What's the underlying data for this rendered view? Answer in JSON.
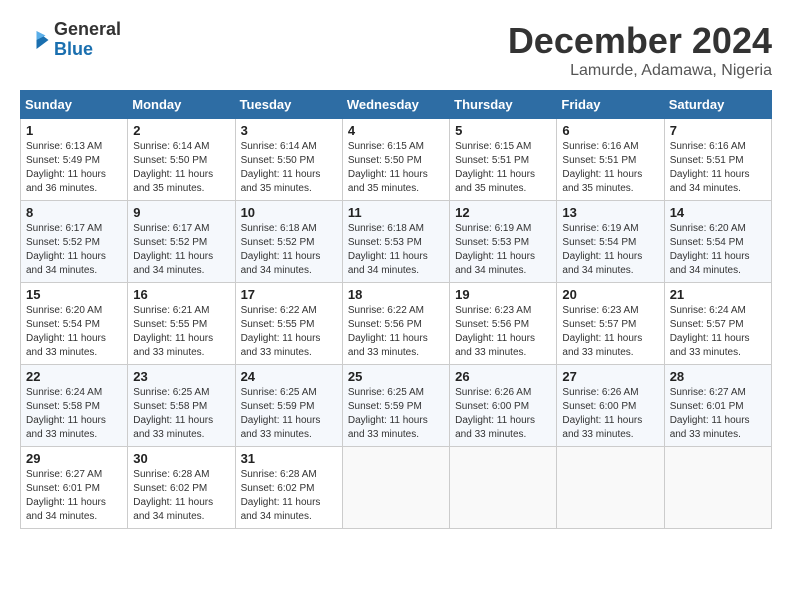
{
  "logo": {
    "general": "General",
    "blue": "Blue"
  },
  "title": "December 2024",
  "subtitle": "Lamurde, Adamawa, Nigeria",
  "days_header": [
    "Sunday",
    "Monday",
    "Tuesday",
    "Wednesday",
    "Thursday",
    "Friday",
    "Saturday"
  ],
  "weeks": [
    [
      {
        "day": "1",
        "sunrise": "6:13 AM",
        "sunset": "5:49 PM",
        "daylight": "11 hours and 36 minutes."
      },
      {
        "day": "2",
        "sunrise": "6:14 AM",
        "sunset": "5:50 PM",
        "daylight": "11 hours and 35 minutes."
      },
      {
        "day": "3",
        "sunrise": "6:14 AM",
        "sunset": "5:50 PM",
        "daylight": "11 hours and 35 minutes."
      },
      {
        "day": "4",
        "sunrise": "6:15 AM",
        "sunset": "5:50 PM",
        "daylight": "11 hours and 35 minutes."
      },
      {
        "day": "5",
        "sunrise": "6:15 AM",
        "sunset": "5:51 PM",
        "daylight": "11 hours and 35 minutes."
      },
      {
        "day": "6",
        "sunrise": "6:16 AM",
        "sunset": "5:51 PM",
        "daylight": "11 hours and 35 minutes."
      },
      {
        "day": "7",
        "sunrise": "6:16 AM",
        "sunset": "5:51 PM",
        "daylight": "11 hours and 34 minutes."
      }
    ],
    [
      {
        "day": "8",
        "sunrise": "6:17 AM",
        "sunset": "5:52 PM",
        "daylight": "11 hours and 34 minutes."
      },
      {
        "day": "9",
        "sunrise": "6:17 AM",
        "sunset": "5:52 PM",
        "daylight": "11 hours and 34 minutes."
      },
      {
        "day": "10",
        "sunrise": "6:18 AM",
        "sunset": "5:52 PM",
        "daylight": "11 hours and 34 minutes."
      },
      {
        "day": "11",
        "sunrise": "6:18 AM",
        "sunset": "5:53 PM",
        "daylight": "11 hours and 34 minutes."
      },
      {
        "day": "12",
        "sunrise": "6:19 AM",
        "sunset": "5:53 PM",
        "daylight": "11 hours and 34 minutes."
      },
      {
        "day": "13",
        "sunrise": "6:19 AM",
        "sunset": "5:54 PM",
        "daylight": "11 hours and 34 minutes."
      },
      {
        "day": "14",
        "sunrise": "6:20 AM",
        "sunset": "5:54 PM",
        "daylight": "11 hours and 34 minutes."
      }
    ],
    [
      {
        "day": "15",
        "sunrise": "6:20 AM",
        "sunset": "5:54 PM",
        "daylight": "11 hours and 33 minutes."
      },
      {
        "day": "16",
        "sunrise": "6:21 AM",
        "sunset": "5:55 PM",
        "daylight": "11 hours and 33 minutes."
      },
      {
        "day": "17",
        "sunrise": "6:22 AM",
        "sunset": "5:55 PM",
        "daylight": "11 hours and 33 minutes."
      },
      {
        "day": "18",
        "sunrise": "6:22 AM",
        "sunset": "5:56 PM",
        "daylight": "11 hours and 33 minutes."
      },
      {
        "day": "19",
        "sunrise": "6:23 AM",
        "sunset": "5:56 PM",
        "daylight": "11 hours and 33 minutes."
      },
      {
        "day": "20",
        "sunrise": "6:23 AM",
        "sunset": "5:57 PM",
        "daylight": "11 hours and 33 minutes."
      },
      {
        "day": "21",
        "sunrise": "6:24 AM",
        "sunset": "5:57 PM",
        "daylight": "11 hours and 33 minutes."
      }
    ],
    [
      {
        "day": "22",
        "sunrise": "6:24 AM",
        "sunset": "5:58 PM",
        "daylight": "11 hours and 33 minutes."
      },
      {
        "day": "23",
        "sunrise": "6:25 AM",
        "sunset": "5:58 PM",
        "daylight": "11 hours and 33 minutes."
      },
      {
        "day": "24",
        "sunrise": "6:25 AM",
        "sunset": "5:59 PM",
        "daylight": "11 hours and 33 minutes."
      },
      {
        "day": "25",
        "sunrise": "6:25 AM",
        "sunset": "5:59 PM",
        "daylight": "11 hours and 33 minutes."
      },
      {
        "day": "26",
        "sunrise": "6:26 AM",
        "sunset": "6:00 PM",
        "daylight": "11 hours and 33 minutes."
      },
      {
        "day": "27",
        "sunrise": "6:26 AM",
        "sunset": "6:00 PM",
        "daylight": "11 hours and 33 minutes."
      },
      {
        "day": "28",
        "sunrise": "6:27 AM",
        "sunset": "6:01 PM",
        "daylight": "11 hours and 33 minutes."
      }
    ],
    [
      {
        "day": "29",
        "sunrise": "6:27 AM",
        "sunset": "6:01 PM",
        "daylight": "11 hours and 34 minutes."
      },
      {
        "day": "30",
        "sunrise": "6:28 AM",
        "sunset": "6:02 PM",
        "daylight": "11 hours and 34 minutes."
      },
      {
        "day": "31",
        "sunrise": "6:28 AM",
        "sunset": "6:02 PM",
        "daylight": "11 hours and 34 minutes."
      },
      null,
      null,
      null,
      null
    ]
  ]
}
